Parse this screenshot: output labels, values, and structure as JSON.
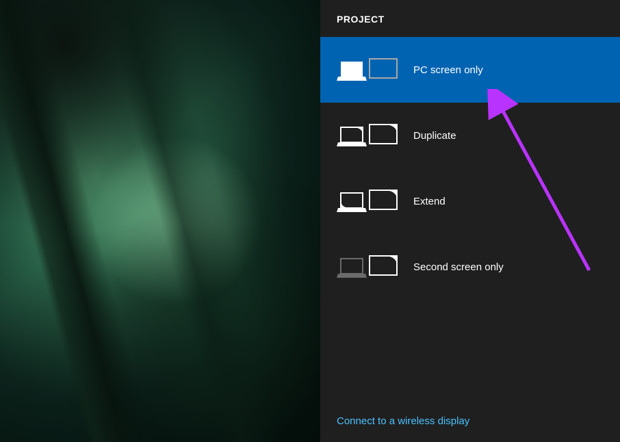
{
  "panel": {
    "title": "PROJECT",
    "options": [
      {
        "label": "PC screen only",
        "selected": true,
        "icon": "pc-screen-only-icon"
      },
      {
        "label": "Duplicate",
        "selected": false,
        "icon": "duplicate-icon"
      },
      {
        "label": "Extend",
        "selected": false,
        "icon": "extend-icon"
      },
      {
        "label": "Second screen only",
        "selected": false,
        "icon": "second-screen-only-icon"
      }
    ],
    "connect_link": "Connect to a wireless display"
  },
  "annotation": {
    "color": "#b933ff"
  }
}
